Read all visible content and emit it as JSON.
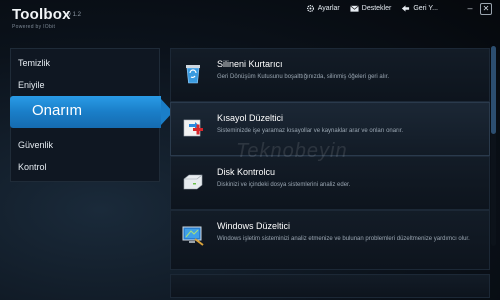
{
  "app": {
    "title": "Toolbox",
    "version": "v 1.2",
    "powered": "Powered by IObit"
  },
  "top_links": [
    {
      "label": "Ayarlar",
      "icon": "gear-icon"
    },
    {
      "label": "Destekler",
      "icon": "mail-icon"
    },
    {
      "label": "Geri Y...",
      "icon": "back-arrow-icon"
    }
  ],
  "nav": {
    "items": [
      {
        "label": "Temizlik"
      },
      {
        "label": "Eniyile"
      },
      {
        "label": "Onarım"
      },
      {
        "label": "Güvenlik"
      },
      {
        "label": "Kontrol"
      }
    ],
    "active_index": 2
  },
  "cards": [
    {
      "title": "Silineni Kurtarıcı",
      "desc": "Geri Dönüşüm Kutusunu boşalttığınızda, silinmiş öğeleri geri alır.",
      "icon": "recycle-bin-icon"
    },
    {
      "title": "Kısayol Düzeltici",
      "desc": "Sisteminizde işe yaramaz kısayollar ve kaynaklar arar ve onları onarır.",
      "icon": "shortcut-fix-icon"
    },
    {
      "title": "Disk Kontrolcu",
      "desc": "Diskinizi ve içindeki dosya sistemlerini analiz eder.",
      "icon": "disk-icon"
    },
    {
      "title": "Windows Düzeltici",
      "desc": "Windows işletim sisteminizi analiz etmenize ve bulunan problemleri düzeltmenize yardımcı olur.",
      "icon": "monitor-fix-icon"
    }
  ],
  "watermark": "Teknobeyin",
  "colors": {
    "accent": "#1a7ec8",
    "background": "#0b121b"
  }
}
